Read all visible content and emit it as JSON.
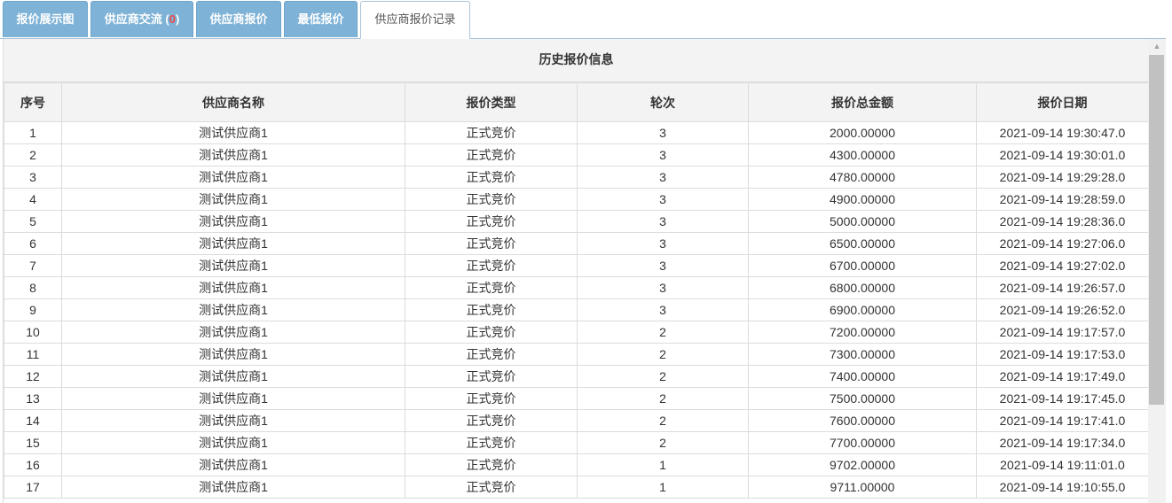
{
  "tabs": [
    {
      "label": "报价展示图"
    },
    {
      "label": "供应商交流",
      "paren_open": "(",
      "badge": "0",
      "paren_close": ")"
    },
    {
      "label": "供应商报价"
    },
    {
      "label": "最低报价"
    },
    {
      "label": "供应商报价记录",
      "active": true
    }
  ],
  "table": {
    "title": "历史报价信息",
    "headers": [
      "序号",
      "供应商名称",
      "报价类型",
      "轮次",
      "报价总金额",
      "报价日期"
    ],
    "rows": [
      [
        "1",
        "测试供应商1",
        "正式竞价",
        "3",
        "2000.00000",
        "2021-09-14 19:30:47.0"
      ],
      [
        "2",
        "测试供应商1",
        "正式竞价",
        "3",
        "4300.00000",
        "2021-09-14 19:30:01.0"
      ],
      [
        "3",
        "测试供应商1",
        "正式竞价",
        "3",
        "4780.00000",
        "2021-09-14 19:29:28.0"
      ],
      [
        "4",
        "测试供应商1",
        "正式竞价",
        "3",
        "4900.00000",
        "2021-09-14 19:28:59.0"
      ],
      [
        "5",
        "测试供应商1",
        "正式竞价",
        "3",
        "5000.00000",
        "2021-09-14 19:28:36.0"
      ],
      [
        "6",
        "测试供应商1",
        "正式竞价",
        "3",
        "6500.00000",
        "2021-09-14 19:27:06.0"
      ],
      [
        "7",
        "测试供应商1",
        "正式竞价",
        "3",
        "6700.00000",
        "2021-09-14 19:27:02.0"
      ],
      [
        "8",
        "测试供应商1",
        "正式竞价",
        "3",
        "6800.00000",
        "2021-09-14 19:26:57.0"
      ],
      [
        "9",
        "测试供应商1",
        "正式竞价",
        "3",
        "6900.00000",
        "2021-09-14 19:26:52.0"
      ],
      [
        "10",
        "测试供应商1",
        "正式竞价",
        "2",
        "7200.00000",
        "2021-09-14 19:17:57.0"
      ],
      [
        "11",
        "测试供应商1",
        "正式竞价",
        "2",
        "7300.00000",
        "2021-09-14 19:17:53.0"
      ],
      [
        "12",
        "测试供应商1",
        "正式竞价",
        "2",
        "7400.00000",
        "2021-09-14 19:17:49.0"
      ],
      [
        "13",
        "测试供应商1",
        "正式竞价",
        "2",
        "7500.00000",
        "2021-09-14 19:17:45.0"
      ],
      [
        "14",
        "测试供应商1",
        "正式竞价",
        "2",
        "7600.00000",
        "2021-09-14 19:17:41.0"
      ],
      [
        "15",
        "测试供应商1",
        "正式竞价",
        "2",
        "7700.00000",
        "2021-09-14 19:17:34.0"
      ],
      [
        "16",
        "测试供应商1",
        "正式竞价",
        "1",
        "9702.00000",
        "2021-09-14 19:11:01.0"
      ],
      [
        "17",
        "测试供应商1",
        "正式竞价",
        "1",
        "9711.00000",
        "2021-09-14 19:10:55.0"
      ]
    ]
  },
  "scrollbar": {
    "up_icon": "triangle-up-icon"
  },
  "colors": {
    "tab_bg": "#7eb2d6",
    "badge": "#e84b4b",
    "header_bg": "#f3f3f3",
    "grid": "#dcdcdc"
  }
}
